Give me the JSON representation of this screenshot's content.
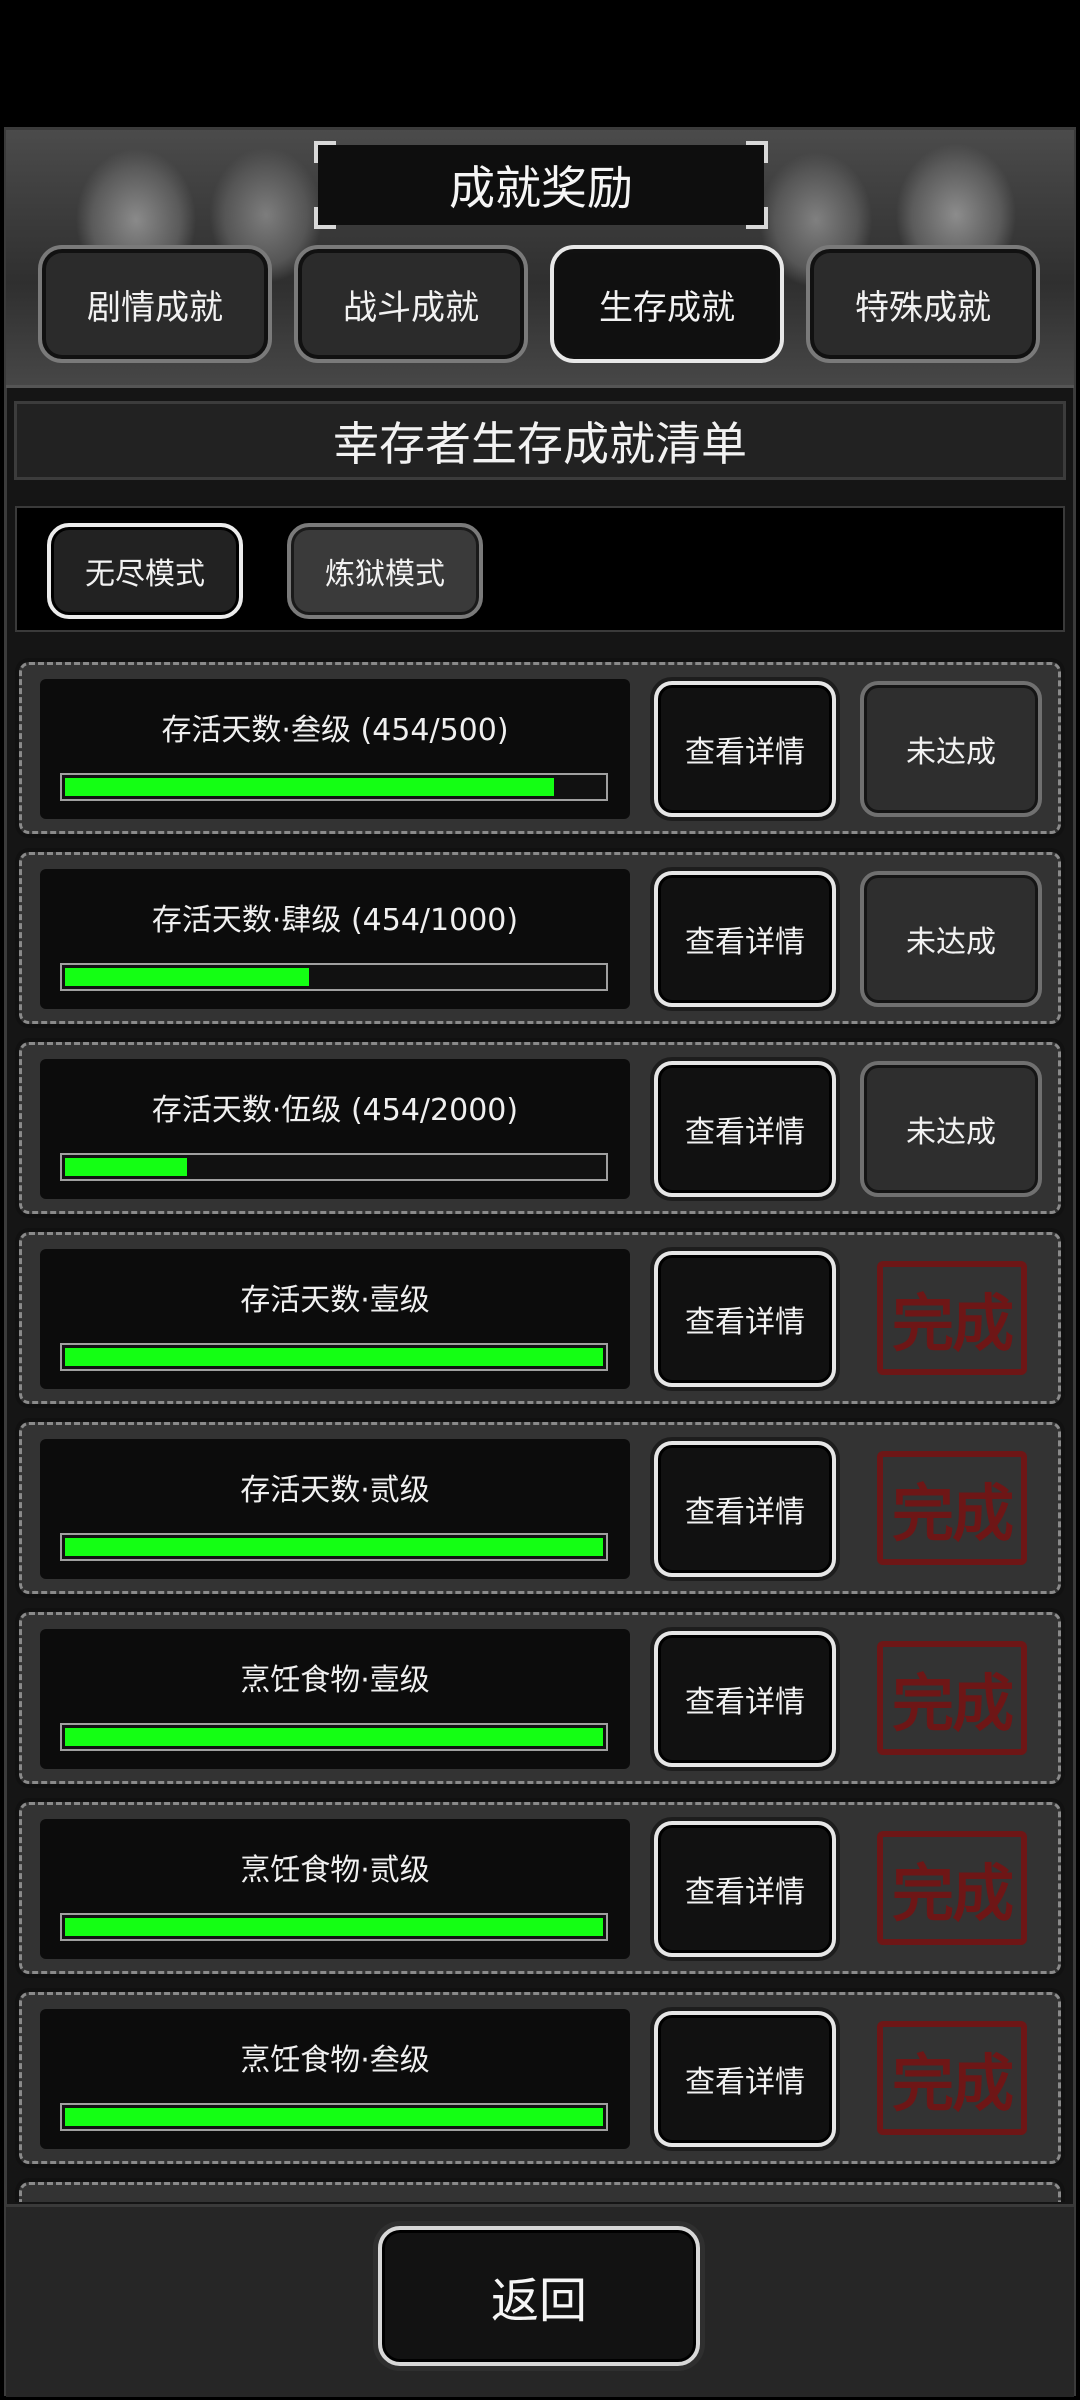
{
  "header": {
    "title": "成就奖励",
    "tabs": [
      {
        "label": "剧情成就",
        "active": false
      },
      {
        "label": "战斗成就",
        "active": false
      },
      {
        "label": "生存成就",
        "active": true
      },
      {
        "label": "特殊成就",
        "active": false
      }
    ]
  },
  "list_title": "幸存者生存成就清单",
  "modes": [
    {
      "label": "无尽模式",
      "active": true
    },
    {
      "label": "炼狱模式",
      "active": false
    }
  ],
  "achievements": [
    {
      "label": "存活天数·叁级 (454/500)",
      "progress": 0.908,
      "detail_label": "查看详情",
      "status": "未达成",
      "completed": false
    },
    {
      "label": "存活天数·肆级 (454/1000)",
      "progress": 0.454,
      "detail_label": "查看详情",
      "status": "未达成",
      "completed": false
    },
    {
      "label": "存活天数·伍级 (454/2000)",
      "progress": 0.227,
      "detail_label": "查看详情",
      "status": "未达成",
      "completed": false
    },
    {
      "label": "存活天数·壹级",
      "progress": 1.0,
      "detail_label": "查看详情",
      "status": "完成",
      "completed": true
    },
    {
      "label": "存活天数·贰级",
      "progress": 1.0,
      "detail_label": "查看详情",
      "status": "完成",
      "completed": true
    },
    {
      "label": "烹饪食物·壹级",
      "progress": 1.0,
      "detail_label": "查看详情",
      "status": "完成",
      "completed": true
    },
    {
      "label": "烹饪食物·贰级",
      "progress": 1.0,
      "detail_label": "查看详情",
      "status": "完成",
      "completed": true
    },
    {
      "label": "烹饪食物·叁级",
      "progress": 1.0,
      "detail_label": "查看详情",
      "status": "完成",
      "completed": true
    }
  ],
  "footer": {
    "back_label": "返回"
  }
}
